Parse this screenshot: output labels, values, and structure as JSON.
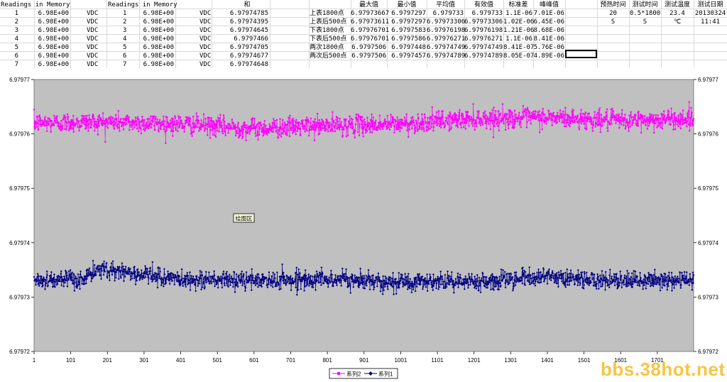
{
  "sheet": {
    "left_block": {
      "header": [
        "Readings in Memory",
        "Readings in Memory",
        "和"
      ],
      "rows": [
        {
          "n1": "1",
          "v1": "6.98E+00",
          "u1": "VDC",
          "n2": "1",
          "v2": "6.98E+00",
          "u2": "VDC",
          "sum": "6.97974785"
        },
        {
          "n1": "2",
          "v1": "6.98E+00",
          "u1": "VDC",
          "n2": "2",
          "v2": "6.98E+00",
          "u2": "VDC",
          "sum": "6.97974395"
        },
        {
          "n1": "3",
          "v1": "6.98E+00",
          "u1": "VDC",
          "n2": "3",
          "v2": "6.98E+00",
          "u2": "VDC",
          "sum": "6.97974645"
        },
        {
          "n1": "4",
          "v1": "6.98E+00",
          "u1": "VDC",
          "n2": "4",
          "v2": "6.98E+00",
          "u2": "VDC",
          "sum": "6.9797466"
        },
        {
          "n1": "5",
          "v1": "6.98E+00",
          "u1": "VDC",
          "n2": "5",
          "v2": "6.98E+00",
          "u2": "VDC",
          "sum": "6.97974705"
        },
        {
          "n1": "6",
          "v1": "6.98E+00",
          "u1": "VDC",
          "n2": "6",
          "v2": "6.98E+00",
          "u2": "VDC",
          "sum": "6.97974677"
        },
        {
          "n1": "7",
          "v1": "6.98E+00",
          "u1": "VDC",
          "n2": "7",
          "v2": "6.98E+00",
          "u2": "VDC",
          "sum": "6.97974648"
        }
      ]
    },
    "stats_block": {
      "headers": [
        "最大值",
        "最小值",
        "平均值",
        "有效值",
        "标准差",
        "峰峰值"
      ],
      "rows": [
        {
          "label": "上表1800点",
          "max": "6.97973667",
          "min": "6.9797297",
          "avg": "6.979733",
          "rms": "6.979733",
          "std": "1.1E-06",
          "pp": "7.01E-06"
        },
        {
          "label": "上表后500点",
          "max": "6.97973611",
          "min": "6.9797297",
          "avg": "6.97973306",
          "rms": "6.97973306",
          "std": "1.02E-06",
          "pp": "6.45E-06"
        },
        {
          "label": "下表1800点",
          "max": "6.97976701",
          "min": "6.9797583",
          "avg": "6.97976198",
          "rms": "6.97976198",
          "std": "1.21E-06",
          "pp": "8.68E-06"
        },
        {
          "label": "下表后500点",
          "max": "6.97976701",
          "min": "6.9797586",
          "avg": "6.97976271",
          "rms": "6.97976271",
          "std": "1.1E-06",
          "pp": "8.41E-06"
        },
        {
          "label": "两次1800点",
          "max": "6.9797506",
          "min": "6.9797448",
          "avg": "6.97974749",
          "rms": "6.97974749",
          "std": "8.41E-07",
          "pp": "5.76E-06"
        },
        {
          "label": "两次后500点",
          "max": "6.9797506",
          "min": "6.9797457",
          "avg": "6.97974789",
          "rms": "6.97974789",
          "std": "8.05E-07",
          "pp": "4.89E-06"
        }
      ]
    },
    "test_block": {
      "headers": [
        "预热时间",
        "测试时间",
        "测试温度",
        "测试日期"
      ],
      "row1": [
        "20",
        "0.5*1800",
        "23.4",
        "20130324"
      ],
      "row2": [
        "S",
        "S",
        "℃",
        "11:41"
      ]
    }
  },
  "chart_data": {
    "type": "line",
    "ylim": [
      6.97972,
      6.97977
    ],
    "y_ticks": [
      "6.97977",
      "6.97976",
      "6.97975",
      "6.97974",
      "6.97973",
      "6.97972"
    ],
    "y_tick_values": [
      6.97977,
      6.97976,
      6.97975,
      6.97974,
      6.97973,
      6.97972
    ],
    "xlim": [
      1,
      1800
    ],
    "x_ticks": [
      "1",
      "101",
      "201",
      "301",
      "401",
      "501",
      "601",
      "701",
      "801",
      "901",
      "1001",
      "1101",
      "1201",
      "1301",
      "1401",
      "1501",
      "1601",
      "1701"
    ],
    "x_tick_values": [
      1,
      101,
      201,
      301,
      401,
      501,
      601,
      701,
      801,
      901,
      1001,
      1101,
      1201,
      1301,
      1401,
      1501,
      1601,
      1701
    ],
    "annotation": "绘图区",
    "legend_position": "bottom",
    "plot_background": "#c0c0c0",
    "series": [
      {
        "name": "系列2",
        "color": "#ff00ff",
        "marker": "square",
        "n_points": 1800,
        "mean": 6.979762,
        "std": 1.2e-06,
        "min": 6.9797583,
        "max": 6.97976701,
        "trend": [
          [
            1,
            6.979762
          ],
          [
            200,
            6.9797622
          ],
          [
            400,
            6.9797618
          ],
          [
            600,
            6.979761
          ],
          [
            800,
            6.9797615
          ],
          [
            1000,
            6.9797618
          ],
          [
            1200,
            6.9797628
          ],
          [
            1400,
            6.979763
          ],
          [
            1600,
            6.9797624
          ],
          [
            1800,
            6.9797628
          ]
        ]
      },
      {
        "name": "系列1",
        "color": "#000080",
        "marker": "diamond",
        "n_points": 1800,
        "mean": 6.979733,
        "std": 1.1e-06,
        "min": 6.9797297,
        "max": 6.97973667,
        "trend": [
          [
            1,
            6.9797332
          ],
          [
            120,
            6.979733
          ],
          [
            190,
            6.9797352
          ],
          [
            280,
            6.9797343
          ],
          [
            400,
            6.9797332
          ],
          [
            600,
            6.979733
          ],
          [
            800,
            6.9797333
          ],
          [
            1000,
            6.9797328
          ],
          [
            1200,
            6.9797329
          ],
          [
            1400,
            6.9797337
          ],
          [
            1600,
            6.9797328
          ],
          [
            1800,
            6.9797333
          ]
        ]
      }
    ]
  },
  "watermark": "bbs.38hot.net"
}
